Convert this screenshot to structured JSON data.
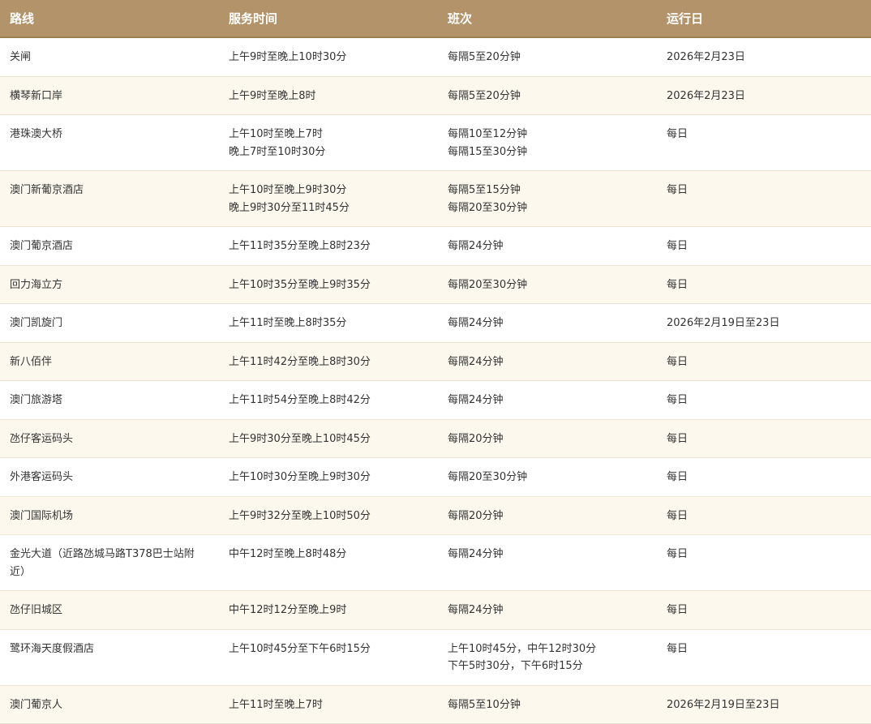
{
  "headers": [
    "路线",
    "服务时间",
    "班次",
    "运行日"
  ],
  "rows": [
    {
      "route": "关闸",
      "hours": [
        "上午9时至晚上10时30分"
      ],
      "freq": [
        "每隔5至20分钟"
      ],
      "days": "2026年2月23日"
    },
    {
      "route": "横琴新口岸",
      "hours": [
        "上午9时至晚上8时"
      ],
      "freq": [
        "每隔5至20分钟"
      ],
      "days": "2026年2月23日"
    },
    {
      "route": "港珠澳大桥",
      "hours": [
        "上午10时至晚上7时",
        "晚上7时至10时30分"
      ],
      "freq": [
        "每隔10至12分钟",
        "每隔15至30分钟"
      ],
      "days": "每日"
    },
    {
      "route": "澳门新葡京酒店",
      "hours": [
        "上午10时至晚上9时30分",
        "晚上9时30分至11时45分"
      ],
      "freq": [
        "每隔5至15分钟",
        "每隔20至30分钟"
      ],
      "days": "每日"
    },
    {
      "route": "澳门葡京酒店",
      "hours": [
        "上午11时35分至晚上8时23分"
      ],
      "freq": [
        "每隔24分钟"
      ],
      "days": "每日"
    },
    {
      "route": "回力海立方",
      "hours": [
        "上午10时35分至晚上9时35分"
      ],
      "freq": [
        "每隔20至30分钟"
      ],
      "days": "每日"
    },
    {
      "route": "澳门凯旋门",
      "hours": [
        "上午11时至晚上8时35分"
      ],
      "freq": [
        "每隔24分钟"
      ],
      "days": "2026年2月19日至23日"
    },
    {
      "route": "新八佰伴",
      "hours": [
        "上午11时42分至晚上8时30分"
      ],
      "freq": [
        "每隔24分钟"
      ],
      "days": "每日"
    },
    {
      "route": "澳门旅游塔",
      "hours": [
        "上午11时54分至晚上8时42分"
      ],
      "freq": [
        "每隔24分钟"
      ],
      "days": "每日"
    },
    {
      "route": "氹仔客运码头",
      "hours": [
        "上午9时30分至晚上10时45分"
      ],
      "freq": [
        "每隔20分钟"
      ],
      "days": "每日"
    },
    {
      "route": "外港客运码头",
      "hours": [
        "上午10时30分至晚上9时30分"
      ],
      "freq": [
        "每隔20至30分钟"
      ],
      "days": "每日"
    },
    {
      "route": "澳门国际机场",
      "hours": [
        "上午9时32分至晚上10时50分"
      ],
      "freq": [
        "每隔20分钟"
      ],
      "days": "每日"
    },
    {
      "route": "金光大道（近路氹城马路T378巴士站附近）",
      "hours": [
        "中午12时至晚上8时48分"
      ],
      "freq": [
        "每隔24分钟"
      ],
      "days": "每日"
    },
    {
      "route": "氹仔旧城区",
      "hours": [
        "中午12时12分至晚上9时"
      ],
      "freq": [
        "每隔24分钟"
      ],
      "days": "每日"
    },
    {
      "route": "鹭环海天度假酒店",
      "hours": [
        "上午10时45分至下午6时15分"
      ],
      "freq": [
        "上午10时45分，中午12时30分",
        "下午5时30分，下午6时15分"
      ],
      "days": "每日"
    },
    {
      "route": "澳门葡京人",
      "hours": [
        "上午11时至晚上7时"
      ],
      "freq": [
        "每隔5至10分钟"
      ],
      "days": "2026年2月19日至23日"
    }
  ]
}
